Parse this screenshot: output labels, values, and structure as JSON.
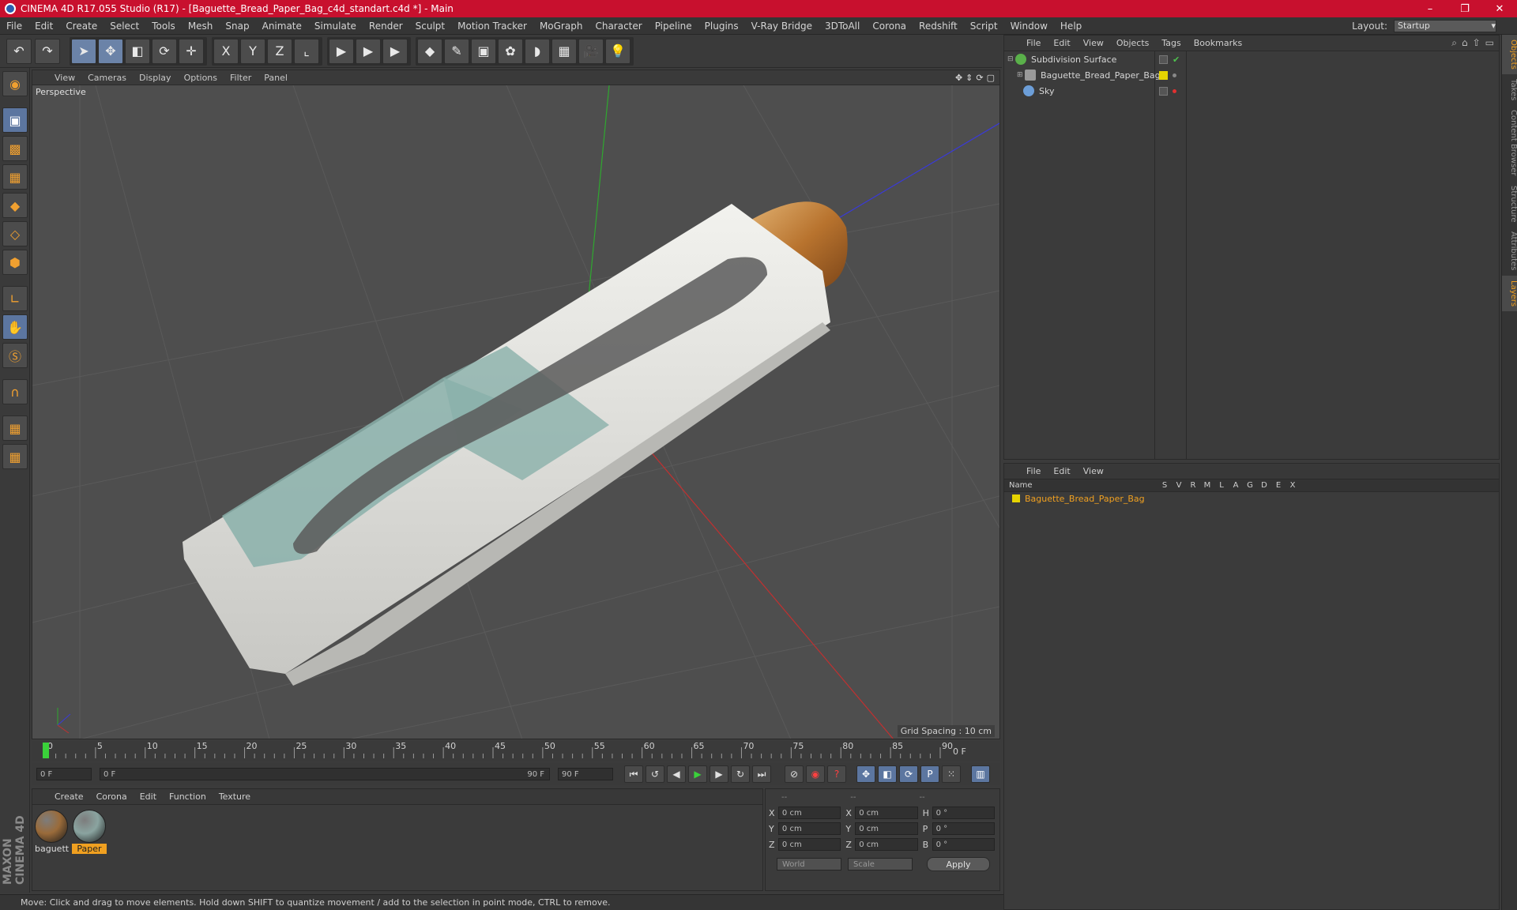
{
  "window": {
    "title": "CINEMA 4D R17.055 Studio (R17) - [Baguette_Bread_Paper_Bag_c4d_standart.c4d *] - Main",
    "minimize": "–",
    "restore": "❐",
    "close": "✕"
  },
  "menubar": {
    "items": [
      "File",
      "Edit",
      "Create",
      "Select",
      "Tools",
      "Mesh",
      "Snap",
      "Animate",
      "Simulate",
      "Render",
      "Sculpt",
      "Motion Tracker",
      "MoGraph",
      "Character",
      "Pipeline",
      "Plugins",
      "V-Ray Bridge",
      "3DToAll",
      "Corona",
      "Redshift",
      "Script",
      "Window",
      "Help"
    ],
    "layout_label": "Layout:",
    "layout_value": "Startup"
  },
  "toolbar": {
    "undo": "↶",
    "redo": "↷",
    "select": "➤",
    "move": "✥",
    "scale": "◧",
    "rotate": "⟳",
    "transform": "✛",
    "x": "X",
    "y": "Y",
    "z": "Z",
    "coord": "⌞",
    "render_view": "▶",
    "render_region": "▶",
    "render_settings": "▶",
    "cube": "◆",
    "pen": "✎",
    "subdiv": "▣",
    "cloner": "✿",
    "deformer": "◗",
    "floor": "▦",
    "camera": "🎥",
    "light": "💡"
  },
  "viewport": {
    "menus": [
      "View",
      "Cameras",
      "Display",
      "Options",
      "Filter",
      "Panel"
    ],
    "label": "Perspective",
    "grid_spacing": "Grid Spacing : 10 cm",
    "nav": [
      "✥",
      "⇕",
      "⟳",
      "▢"
    ]
  },
  "timeline": {
    "ticks": [
      "0",
      "5",
      "10",
      "15",
      "20",
      "25",
      "30",
      "35",
      "40",
      "45",
      "50",
      "55",
      "60",
      "65",
      "70",
      "75",
      "80",
      "85",
      "90"
    ],
    "current_frame": "0 F",
    "start_field": "0 F",
    "range_start": "0 F",
    "range_end": "90 F",
    "end_field": "90 F"
  },
  "transport": {
    "first": "⏮",
    "prev_key": "↺",
    "prev": "◀",
    "play": "▶",
    "next": "▶",
    "next_key": "↻",
    "last": "⏭"
  },
  "materials": {
    "menus": [
      "Create",
      "Corona",
      "Edit",
      "Function",
      "Texture"
    ],
    "items": [
      {
        "name": "baguett",
        "color": "#9a6b3a"
      },
      {
        "name": "Paper",
        "color": "#8aa4a0"
      }
    ]
  },
  "coordinates": {
    "head": [
      "--",
      "--",
      "--"
    ],
    "rows": [
      {
        "a": "X",
        "av": "0 cm",
        "b": "X",
        "bv": "0 cm",
        "c": "H",
        "cv": "0 °"
      },
      {
        "a": "Y",
        "av": "0 cm",
        "b": "Y",
        "bv": "0 cm",
        "c": "P",
        "cv": "0 °"
      },
      {
        "a": "Z",
        "av": "0 cm",
        "b": "Z",
        "bv": "0 cm",
        "c": "B",
        "cv": "0 °"
      }
    ],
    "world": "World",
    "scale": "Scale",
    "apply": "Apply"
  },
  "objects": {
    "menus": [
      "File",
      "Edit",
      "View",
      "Objects",
      "Tags",
      "Bookmarks"
    ],
    "items": [
      {
        "name": "Subdivision Surface",
        "color": "#5ab04a"
      },
      {
        "name": "Baguette_Bread_Paper_Bag",
        "color": "#9a9a9a"
      },
      {
        "name": "Sky",
        "color": "#6c9ed8"
      }
    ]
  },
  "layers": {
    "menus": [
      "File",
      "Edit",
      "View"
    ],
    "columns": [
      "Name",
      "S",
      "V",
      "R",
      "M",
      "L",
      "A",
      "G",
      "D",
      "E",
      "X"
    ],
    "rows": [
      {
        "name": "Baguette_Bread_Paper_Bag"
      }
    ]
  },
  "side_tabs": [
    "Objects",
    "Takes",
    "Content Browser",
    "Structure",
    "Attributes",
    "Layers"
  ],
  "status": "Move: Click and drag to move elements. Hold down SHIFT to quantize movement / add to the selection in point mode, CTRL to remove.",
  "brand": "MAXON CINEMA 4D"
}
